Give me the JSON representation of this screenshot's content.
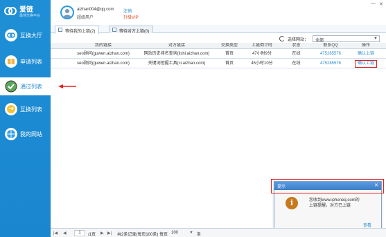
{
  "brand": {
    "name": "爱链",
    "tagline": "最佳交换平台"
  },
  "sidebar": {
    "items": [
      {
        "label": "互换大厅",
        "color": "#e8f4fc"
      },
      {
        "label": "申请列表",
        "color": "#f4b648"
      },
      {
        "label": "通过列表",
        "color": "#5aa95a"
      },
      {
        "label": "互换列表",
        "color": "#f4c23a"
      },
      {
        "label": "我的网站",
        "color": "#e8f4fc"
      }
    ],
    "active_index": 2
  },
  "header": {
    "email": "aizhan004@qq.com",
    "user_type": "超级用户",
    "logout": "注销",
    "upgrade": "升级VIP"
  },
  "tabs": [
    {
      "label": "等待我的上链(2)"
    },
    {
      "label": "等待对方上链(0)"
    }
  ],
  "filter": {
    "label": "选择网站：",
    "selected": "全部"
  },
  "table": {
    "columns": [
      "",
      "我的链接",
      "对方链接",
      "交换类型",
      "上链倒计时",
      "状态",
      "联系QQ",
      "操作"
    ],
    "rows": [
      {
        "my_link": "seo顾问(guwen.aizhan.com)",
        "their_link": "网站历史排名查询(lishi.aizhan.com)",
        "type": "首页",
        "countdown": "47小时9分",
        "status": "在线",
        "qq": "475285576",
        "action": "确认上链"
      },
      {
        "my_link": "seo顾问(guwen.aizhan.com)",
        "their_link": "关键词挖掘工具(ci.aizhan.com)",
        "type": "首页",
        "countdown": "45小时10分",
        "status": "在线",
        "qq": "475285576",
        "action": "确认上链"
      }
    ]
  },
  "popup": {
    "title": "提示",
    "line1": "您收到www.iphoneq.com的",
    "line2": "上链提醒，对方已上链",
    "view": "查看"
  },
  "footer": {
    "page": "1",
    "total_pages": "/1页",
    "summary": "共2条记录(每页100条)",
    "per_page_label": "每页",
    "per_page": "100",
    "unit": "条"
  }
}
